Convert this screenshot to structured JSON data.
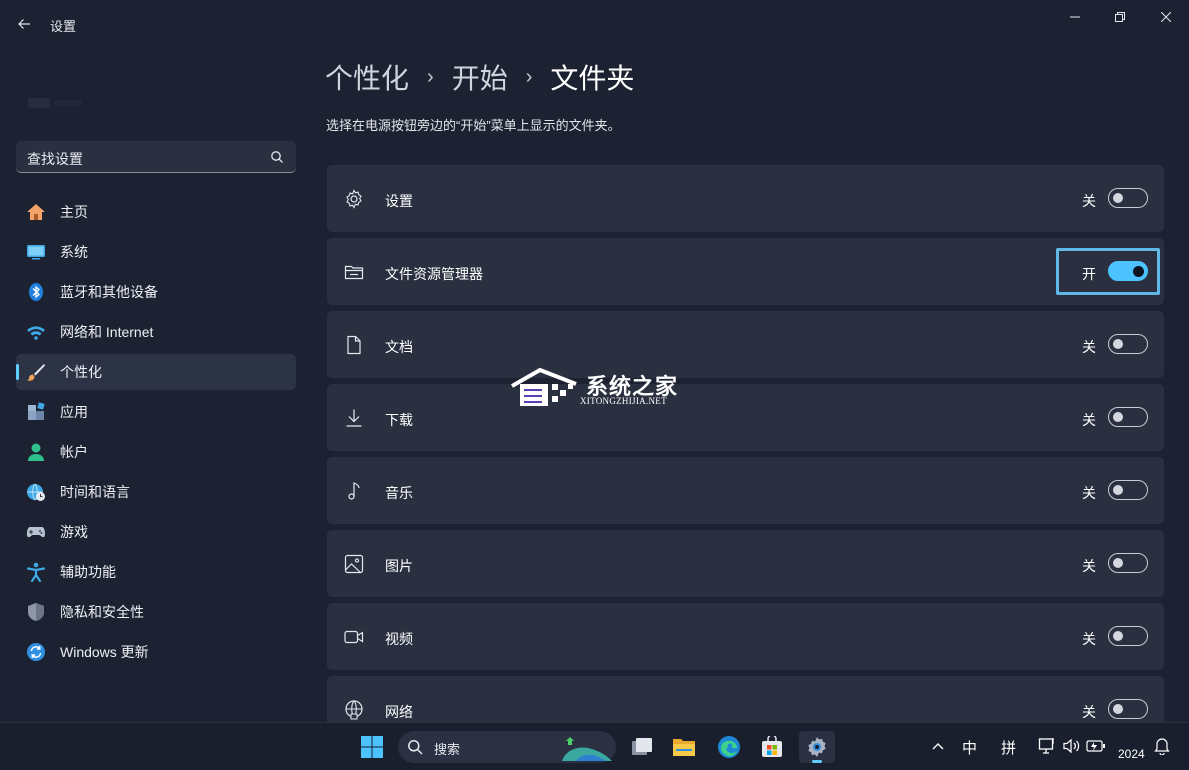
{
  "window": {
    "title": "设置",
    "back_icon": "back-arrow-icon",
    "controls": [
      "minimize-icon",
      "maximize-icon",
      "close-icon"
    ]
  },
  "sidebar": {
    "search_placeholder": "查找设置",
    "items": [
      {
        "label": "主页",
        "icon": "home-icon"
      },
      {
        "label": "系统",
        "icon": "display-icon"
      },
      {
        "label": "蓝牙和其他设备",
        "icon": "bluetooth-icon"
      },
      {
        "label": "网络和 Internet",
        "icon": "wifi-icon"
      },
      {
        "label": "个性化",
        "icon": "paintbrush-icon",
        "active": true
      },
      {
        "label": "应用",
        "icon": "apps-icon"
      },
      {
        "label": "帐户",
        "icon": "account-icon"
      },
      {
        "label": "时间和语言",
        "icon": "globe-clock-icon"
      },
      {
        "label": "游戏",
        "icon": "gamepad-icon"
      },
      {
        "label": "辅助功能",
        "icon": "accessibility-icon"
      },
      {
        "label": "隐私和安全性",
        "icon": "shield-icon"
      },
      {
        "label": "Windows 更新",
        "icon": "update-icon"
      }
    ]
  },
  "main": {
    "breadcrumb": [
      "个性化",
      "开始",
      "文件夹"
    ],
    "description": "选择在电源按钮旁边的“开始”菜单上显示的文件夹。",
    "folders": [
      {
        "label": "设置",
        "icon": "gear-icon",
        "state": "关",
        "on": false
      },
      {
        "label": "文件资源管理器",
        "icon": "folder-icon",
        "state": "开",
        "on": true,
        "focused": true
      },
      {
        "label": "文档",
        "icon": "document-icon",
        "state": "关",
        "on": false
      },
      {
        "label": "下载",
        "icon": "download-icon",
        "state": "关",
        "on": false
      },
      {
        "label": "音乐",
        "icon": "music-icon",
        "state": "关",
        "on": false
      },
      {
        "label": "图片",
        "icon": "picture-icon",
        "state": "关",
        "on": false
      },
      {
        "label": "视频",
        "icon": "video-icon",
        "state": "关",
        "on": false
      },
      {
        "label": "网络",
        "icon": "network-icon",
        "state": "关",
        "on": false
      }
    ]
  },
  "watermark": {
    "title": "系统之家",
    "subtitle": "XITONGZHIJIA.NET"
  },
  "taskbar": {
    "search_label": "搜索",
    "apps": [
      "start-icon",
      "task-view-icon",
      "file-explorer-icon",
      "edge-icon",
      "store-icon",
      "settings-icon"
    ],
    "tray": {
      "ime_mode": "中",
      "ime_name": "拼",
      "clock": "2024"
    }
  },
  "colors": {
    "background": "#1c2231",
    "card": "#2a3040",
    "accent": "#4cc2ff",
    "focus_ring": "#5fb8e8"
  }
}
